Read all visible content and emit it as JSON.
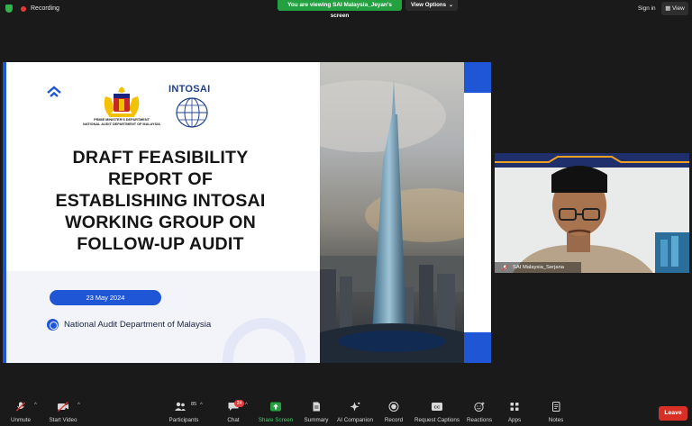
{
  "topbar": {
    "recording_label": "Recording",
    "viewing_banner": "You are viewing SAI Malaysia_Jeyan's screen",
    "view_options_label": "View Options",
    "sign_in_label": "Sign in",
    "view_label": "View"
  },
  "slide": {
    "crest_caption_line1": "PRIME MINISTER'S DEPARTMENT",
    "crest_caption_line2": "NATIONAL AUDIT DEPARTMENT OF MALAYSIA",
    "intosai_label": "INTOSAI",
    "title_line1": "DRAFT FEASIBILITY",
    "title_line2": "REPORT OF",
    "title_line3": "ESTABLISHING INTOSAI",
    "title_line4": "WORKING GROUP ON",
    "title_line5": "FOLLOW-UP AUDIT",
    "date": "23 May 2024",
    "department": "National Audit Department of Malaysia"
  },
  "participant": {
    "name": "SAI Malaysia_Serjana"
  },
  "toolbar": {
    "unmute": "Unmute",
    "start_video": "Start Video",
    "participants": "Participants",
    "participants_count": "85",
    "chat": "Chat",
    "chat_badge": "24",
    "share_screen": "Share Screen",
    "summary": "Summary",
    "ai_companion": "AI Companion",
    "record": "Record",
    "request_captions": "Request Captions",
    "reactions": "Reactions",
    "apps": "Apps",
    "notes": "Notes",
    "leave": "Leave"
  },
  "colors": {
    "accent_green": "#23a140",
    "slide_blue": "#1e56d6",
    "leave_red": "#d93025"
  }
}
